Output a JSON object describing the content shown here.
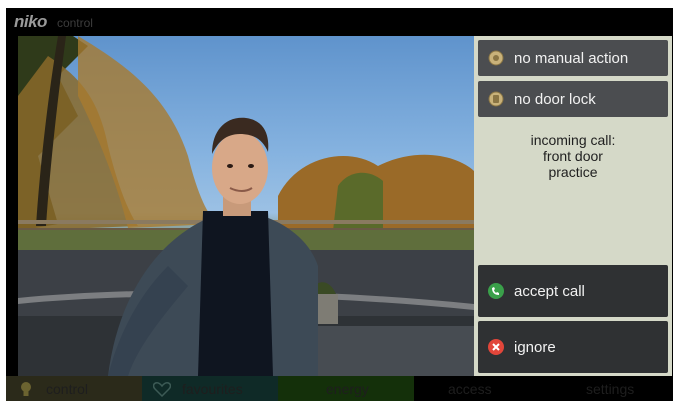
{
  "brand": {
    "logo": "niko",
    "subtitle": "control"
  },
  "panel": {
    "buttons": [
      {
        "label": "no manual action",
        "icon": "manual-action-icon"
      },
      {
        "label": "no door lock",
        "icon": "door-lock-icon"
      }
    ],
    "call_info": {
      "line1": "incoming call:",
      "line2": "front door",
      "line3": "practice"
    },
    "accept": {
      "label": "accept call",
      "icon": "phone-accept-icon",
      "color": "#3aa04a"
    },
    "ignore": {
      "label": "ignore",
      "icon": "reject-icon",
      "color": "#e2463a"
    }
  },
  "nav": {
    "tabs": [
      {
        "label": "control",
        "icon": "lightbulb-icon",
        "color": "#2b2a1a"
      },
      {
        "label": "favourites",
        "icon": "heart-icon",
        "color": "#0f2a27"
      },
      {
        "label": "energy",
        "icon": "",
        "color": "#14300a"
      },
      {
        "label": "access",
        "icon": "",
        "color": "#000000"
      },
      {
        "label": "settings",
        "icon": "",
        "color": "#000000"
      }
    ]
  }
}
